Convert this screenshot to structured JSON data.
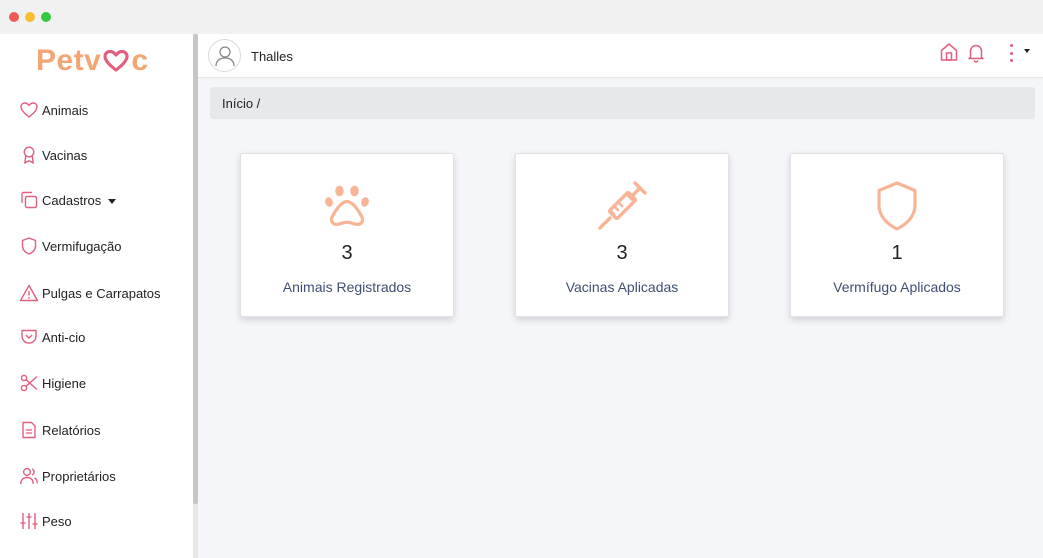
{
  "app": {
    "logo_text_left": "Petv",
    "logo_text_right": "c",
    "brand_color": "#f3a574",
    "accent_color": "#e25f7f"
  },
  "sidebar": {
    "items": [
      {
        "label": "Animais",
        "icon": "heart-icon"
      },
      {
        "label": "Vacinas",
        "icon": "award-icon"
      },
      {
        "label": "Cadastros",
        "icon": "copy-icon",
        "has_dropdown": true
      },
      {
        "label": "Vermifugação",
        "icon": "shield-icon"
      },
      {
        "label": "Pulgas e Carrapatos",
        "icon": "warning-icon"
      },
      {
        "label": "Anti-cio",
        "icon": "pocket-icon"
      },
      {
        "label": "Higiene",
        "icon": "scissors-icon"
      },
      {
        "label": "Relatórios",
        "icon": "file-text-icon"
      },
      {
        "label": "Proprietários",
        "icon": "users-icon"
      },
      {
        "label": "Peso",
        "icon": "sliders-icon"
      }
    ]
  },
  "topbar": {
    "username": "Thalles",
    "icons": [
      "home-icon",
      "bell-icon",
      "kebab-menu-icon"
    ]
  },
  "breadcrumb": {
    "text": "Início /"
  },
  "cards": [
    {
      "count": "3",
      "label": "Animais Registrados",
      "icon": "paw-icon"
    },
    {
      "count": "3",
      "label": "Vacinas Aplicadas",
      "icon": "syringe-icon"
    },
    {
      "count": "1",
      "label": "Vermífugo Aplicados",
      "icon": "shield-icon"
    }
  ]
}
